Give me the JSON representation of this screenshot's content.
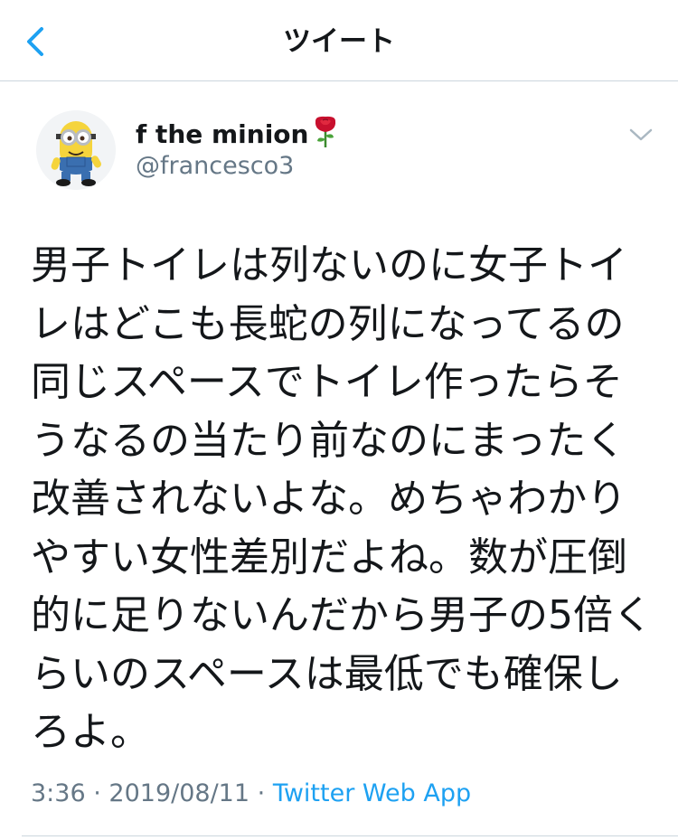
{
  "header": {
    "title": "ツイート",
    "back_icon": "chevron-left-icon",
    "accent_color": "#1da1f2"
  },
  "tweet": {
    "author": {
      "display_name": "f the minion",
      "handle": "@francesco3",
      "name_emoji": "rose-icon",
      "avatar": "minion-avatar"
    },
    "text": "男子トイレは列ないのに女子トイレはどこも長蛇の列になってるの同じスペースでトイレ作ったらそうなるの当たり前なのにまったく改善されないよな。めちゃわかりやすい女性差別だよね。数が圧倒的に足りないんだから男子の5倍くらいのスペースは最低でも確保しろよ。",
    "time": "3:36",
    "separator": "·",
    "date": "2019/08/11",
    "source": "Twitter Web App"
  },
  "colors": {
    "text": "#14171a",
    "secondary": "#657786",
    "link": "#1da1f2",
    "divider": "#ccd6dd"
  }
}
